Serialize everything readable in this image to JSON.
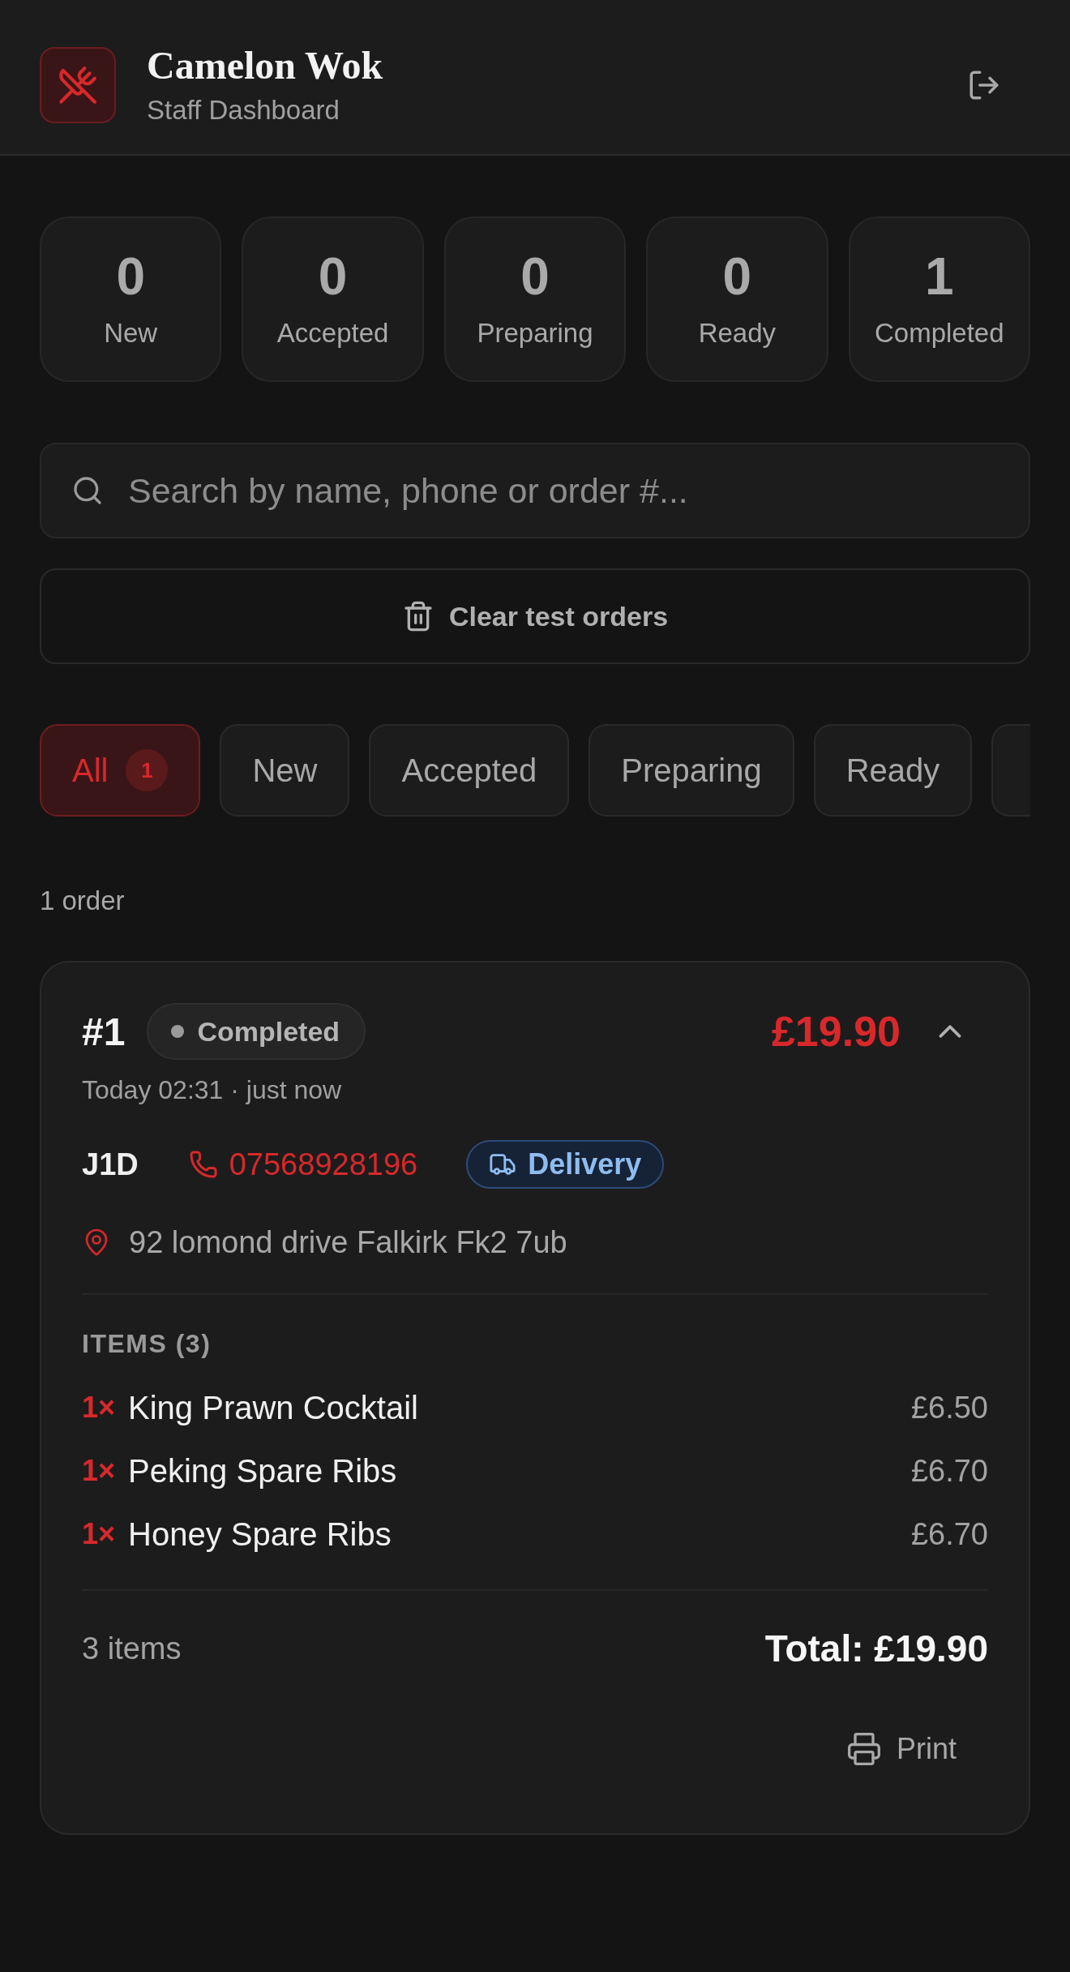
{
  "header": {
    "title": "Camelon Wok",
    "subtitle": "Staff Dashboard"
  },
  "stats": [
    {
      "value": "0",
      "label": "New"
    },
    {
      "value": "0",
      "label": "Accepted"
    },
    {
      "value": "0",
      "label": "Preparing"
    },
    {
      "value": "0",
      "label": "Ready"
    },
    {
      "value": "1",
      "label": "Completed"
    }
  ],
  "search": {
    "placeholder": "Search by name, phone or order #..."
  },
  "clear_button": {
    "label": "Clear test orders"
  },
  "filter_tabs": [
    {
      "label": "All",
      "count": "1",
      "selected": true
    },
    {
      "label": "New",
      "selected": false
    },
    {
      "label": "Accepted",
      "selected": false
    },
    {
      "label": "Preparing",
      "selected": false
    },
    {
      "label": "Ready",
      "selected": false
    },
    {
      "selected": false
    }
  ],
  "order_count": "1 order",
  "orders": [
    {
      "number": "#1",
      "status": {
        "kind": "completed",
        "label": "Completed"
      },
      "price": "£19.90",
      "expanded": true,
      "time": "Today 02:31 · just now",
      "customer": "J1D",
      "phone": "07568928196",
      "order_type": {
        "kind": "delivery",
        "label": "Delivery"
      },
      "address": "92 lomond drive Falkirk Fk2 7ub",
      "items_heading": "ITEMS (3)",
      "items": [
        {
          "qty": "1×",
          "name": "King Prawn Cocktail",
          "price": "£6.50"
        },
        {
          "qty": "1×",
          "name": "Peking Spare Ribs",
          "price": "£6.70"
        },
        {
          "qty": "1×",
          "name": "Honey Spare Ribs",
          "price": "£6.70"
        }
      ],
      "items_count": "3 items",
      "total": "Total: £19.90",
      "print_button": {
        "label": "Print"
      }
    }
  ]
}
